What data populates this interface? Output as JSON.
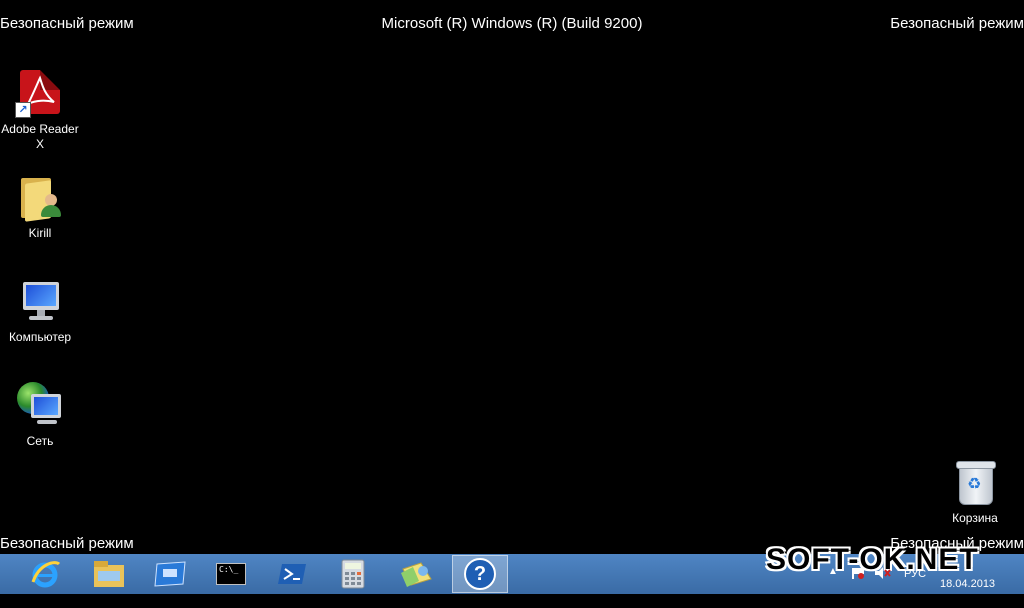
{
  "screen": {
    "safe_mode_label": "Безопасный режим",
    "build_text": "Microsoft (R) Windows (R) (Build 9200)"
  },
  "desktop_icons": [
    {
      "label": "Adobe Reader X",
      "icon": "adobe-reader-icon"
    },
    {
      "label": "Kirill",
      "icon": "user-folder-icon"
    },
    {
      "label": "Компьютер",
      "icon": "computer-icon"
    },
    {
      "label": "Сеть",
      "icon": "network-icon"
    },
    {
      "label": "Корзина",
      "icon": "recycle-bin-icon"
    }
  ],
  "taskbar": {
    "buttons": [
      {
        "icon": "internet-explorer-icon"
      },
      {
        "icon": "file-explorer-icon"
      },
      {
        "icon": "window-app-icon"
      },
      {
        "icon": "command-prompt-icon",
        "text": "C:\\_"
      },
      {
        "icon": "powershell-icon"
      },
      {
        "icon": "calculator-icon"
      },
      {
        "icon": "paint-icon"
      },
      {
        "icon": "help-icon",
        "text": "?",
        "active": true
      }
    ],
    "tray": {
      "language": "РУС",
      "date": "18.04.2013"
    }
  },
  "watermark": "SOFT-OK.NET",
  "colors": {
    "desktop_bg": "#000000",
    "taskbar": "#4a7fc0",
    "text": "#ffffff"
  }
}
